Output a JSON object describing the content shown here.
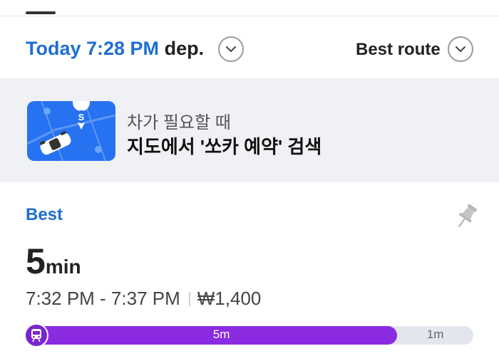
{
  "header": {
    "departure_time": "Today 7:28 PM",
    "departure_suffix": "dep.",
    "route_option": "Best route"
  },
  "banner": {
    "subtitle": "차가 필요할 때",
    "title": "지도에서 '쏘카 예약' 검색",
    "accent_color": "#2672f0"
  },
  "route": {
    "tag": "Best",
    "duration_value": "5",
    "duration_unit": "min",
    "time_range": "7:32 PM - 7:37 PM",
    "fare": "₩1,400",
    "segments": [
      {
        "label": "5m",
        "mode": "subway",
        "color": "#8a2be2",
        "share": 0.83
      },
      {
        "label": "1m",
        "mode": "walk",
        "color": "#e3e6ec",
        "share": 0.17
      }
    ]
  },
  "colors": {
    "primary_blue": "#1f6fd1",
    "subway_purple": "#8a2be2"
  }
}
